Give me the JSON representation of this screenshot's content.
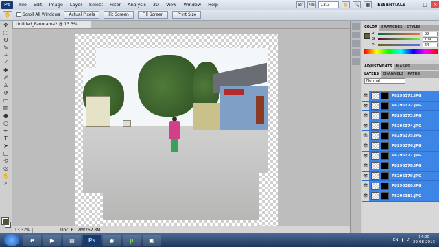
{
  "app": {
    "logo": "Ps",
    "menus": [
      "File",
      "Edit",
      "Image",
      "Layer",
      "Select",
      "Filter",
      "Analysis",
      "3D",
      "View",
      "Window",
      "Help"
    ],
    "zoom": "13.3",
    "workspace": "ESSENTIALS"
  },
  "options": {
    "scroll_all": "Scroll All Windows",
    "buttons": [
      "Actual Pixels",
      "Fit Screen",
      "Fill Screen",
      "Print Size"
    ]
  },
  "document": {
    "tab_title": "Untitled_Panorama2 @ 13.3% (RGB/8) *",
    "zoom_status": "13.32%",
    "doc_size": "Doc: 61.2M/262.8M"
  },
  "color_panel": {
    "tabs": [
      "COLOR",
      "SWATCHES",
      "STYLES"
    ],
    "channels": [
      {
        "label": "R",
        "value": "99"
      },
      {
        "label": "G",
        "value": "109"
      },
      {
        "label": "B",
        "value": "64"
      }
    ],
    "swatch_color": "#63632e"
  },
  "adjust_tabs": [
    "ADJUSTMENTS",
    "MASKS"
  ],
  "layers_panel": {
    "tabs": [
      "LAYERS",
      "CHANNELS",
      "PATHS"
    ],
    "blend_mode": "Normal",
    "layers": [
      "P8296371.JPG",
      "P8296372.JPG",
      "P8296373.JPG",
      "P8296374.JPG",
      "P8296375.JPG",
      "P8296376.JPG",
      "P8296377.JPG",
      "P8296378.JPG",
      "P8296379.JPG",
      "P8296380.JPG",
      "P8296381.JPG"
    ]
  },
  "taskbar": {
    "lang": "EN",
    "time": "14:20",
    "date": "29-08-2013"
  }
}
